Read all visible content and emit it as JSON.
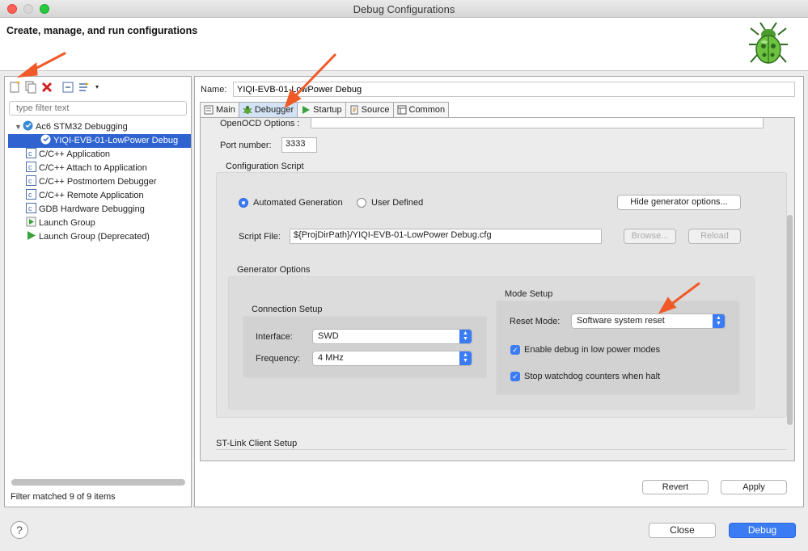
{
  "window": {
    "title": "Debug Configurations"
  },
  "header": {
    "title": "Create, manage, and run configurations"
  },
  "left": {
    "filter_placeholder": "type filter text",
    "tree": [
      {
        "label": "Ac6 STM32 Debugging",
        "level": 0,
        "expanded": true,
        "icon": "stm32-icon"
      },
      {
        "label": "YIQI-EVB-01-LowPower Debug",
        "level": 1,
        "selected": true,
        "icon": "stm32-icon"
      },
      {
        "label": "C/C++ Application",
        "level": 0,
        "icon": "c-app-icon"
      },
      {
        "label": "C/C++ Attach to Application",
        "level": 0,
        "icon": "c-app-icon"
      },
      {
        "label": "C/C++ Postmortem Debugger",
        "level": 0,
        "icon": "c-app-icon"
      },
      {
        "label": "C/C++ Remote Application",
        "level": 0,
        "icon": "c-app-icon"
      },
      {
        "label": "GDB Hardware Debugging",
        "level": 0,
        "icon": "c-app-icon"
      },
      {
        "label": "Launch Group",
        "level": 0,
        "icon": "launch-group-icon"
      },
      {
        "label": "Launch Group (Deprecated)",
        "level": 0,
        "icon": "launch-arrow-icon"
      }
    ],
    "status": "Filter matched 9 of 9 items"
  },
  "right": {
    "name_label": "Name:",
    "name_value": "YIQI-EVB-01-LowPower Debug",
    "tabs": [
      {
        "label": "Main",
        "icon": "main-tab-icon"
      },
      {
        "label": "Debugger",
        "icon": "bug-icon",
        "active": true
      },
      {
        "label": "Startup",
        "icon": "startup-icon"
      },
      {
        "label": "Source",
        "icon": "source-icon"
      },
      {
        "label": "Common",
        "icon": "common-icon"
      }
    ],
    "openocd_label": "OpenOCD Options :",
    "port_label": "Port number:",
    "port_value": "3333",
    "config_script_label": "Configuration Script",
    "radio_auto": "Automated Generation",
    "radio_user": "User Defined",
    "hide_gen_button": "Hide generator options...",
    "script_file_label": "Script File:",
    "script_file_value": "${ProjDirPath}/YIQI-EVB-01-LowPower Debug.cfg",
    "browse_button": "Browse...",
    "reload_button": "Reload",
    "generator_options_label": "Generator Options",
    "connection_setup_label": "Connection Setup",
    "interface_label": "Interface:",
    "interface_value": "SWD",
    "frequency_label": "Frequency:",
    "frequency_value": "4 MHz",
    "mode_setup_label": "Mode Setup",
    "reset_mode_label": "Reset Mode:",
    "reset_mode_value": "Software system reset",
    "check_low_power": "Enable debug in low power modes",
    "check_watchdog": "Stop watchdog counters when halt",
    "stlink_label": "ST-Link Client Setup",
    "revert_button": "Revert",
    "apply_button": "Apply"
  },
  "footer": {
    "help_label": "?",
    "close_button": "Close",
    "debug_button": "Debug"
  },
  "colors": {
    "accent": "#3b7cf5",
    "selection": "#2f64d0",
    "annotation_arrow": "#f05a28"
  }
}
